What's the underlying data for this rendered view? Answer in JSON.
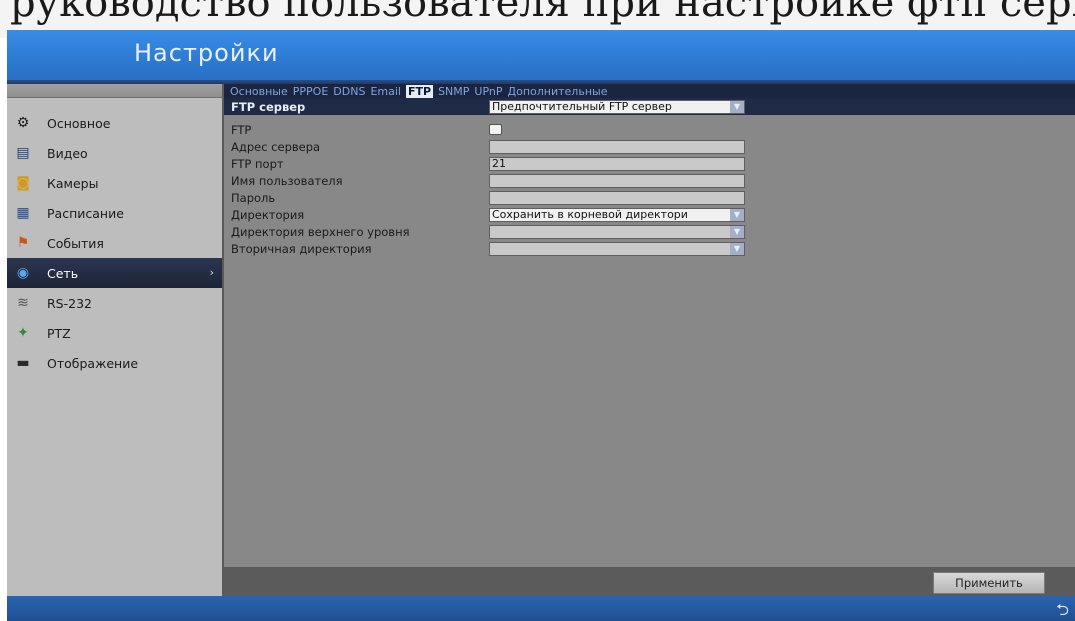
{
  "page_fragment": "руководство пользователя при настройке фтп сервера",
  "header": {
    "title": "Настройки"
  },
  "sidebar": {
    "items": [
      {
        "label": "Основное",
        "icon": "gear-icon"
      },
      {
        "label": "Видео",
        "icon": "film-icon"
      },
      {
        "label": "Камеры",
        "icon": "camera-icon"
      },
      {
        "label": "Расписание",
        "icon": "calendar-icon"
      },
      {
        "label": "События",
        "icon": "flag-icon"
      },
      {
        "label": "Сеть",
        "icon": "globe-icon",
        "active": true
      },
      {
        "label": "RS-232",
        "icon": "serial-icon"
      },
      {
        "label": "PTZ",
        "icon": "ptz-icon"
      },
      {
        "label": "Отображение",
        "icon": "monitor-icon"
      }
    ]
  },
  "tabs": [
    {
      "label": "Основные"
    },
    {
      "label": "PPPOE"
    },
    {
      "label": "DDNS"
    },
    {
      "label": "Email"
    },
    {
      "label": "FTP",
      "active": true
    },
    {
      "label": "SNMP"
    },
    {
      "label": "UPnP"
    },
    {
      "label": "Дополнительные"
    }
  ],
  "form": {
    "server_label": "FTP сервер",
    "server_value": "Предпочтительный FTP сервер",
    "ftp_label": "FTP",
    "address_label": "Адрес сервера",
    "address_value": "",
    "port_label": "FTP порт",
    "port_value": "21",
    "user_label": "Имя пользователя",
    "user_value": "",
    "password_label": "Пароль",
    "password_value": "",
    "dir_label": "Директория",
    "dir_value": "Сохранить в корневой директори",
    "topdir_label": "Директория верхнего уровня",
    "topdir_value": "",
    "subdir_label": "Вторичная директория",
    "subdir_value": ""
  },
  "buttons": {
    "apply": "Применить"
  },
  "colors": {
    "header_blue": "#2f7fd8",
    "tab_bar": "#1c2540",
    "active_nav": "#1d2438"
  }
}
